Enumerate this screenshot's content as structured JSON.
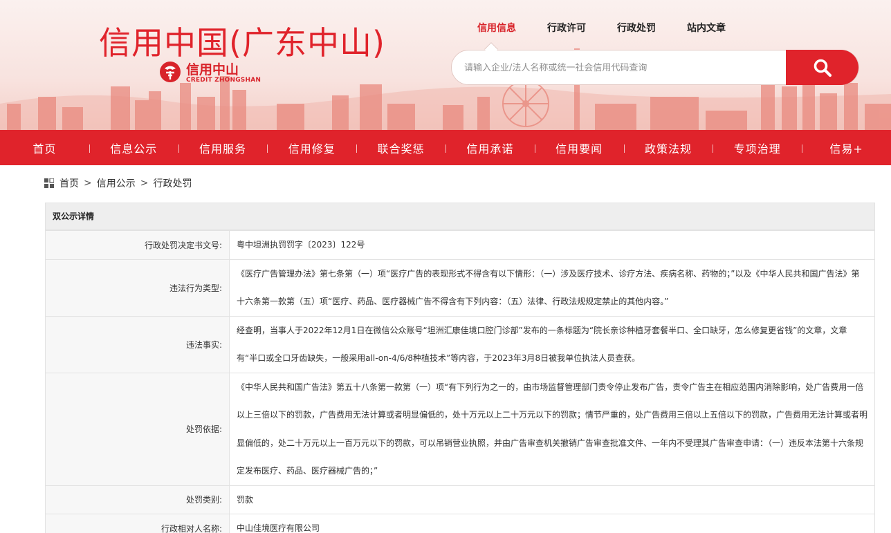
{
  "header": {
    "site_title": "信用中国(广东中山)",
    "logo_cn": "信用中山",
    "logo_en": "CREDIT ZHONGSHAN",
    "top_tabs": [
      {
        "label": "信用信息",
        "active": true
      },
      {
        "label": "行政许可",
        "active": false
      },
      {
        "label": "行政处罚",
        "active": false
      },
      {
        "label": "站内文章",
        "active": false
      }
    ],
    "search": {
      "placeholder": "请输入企业/法人名称或统一社会信用代码查询",
      "value": ""
    }
  },
  "nav": {
    "items": [
      "首页",
      "信息公示",
      "信用服务",
      "信用修复",
      "联合奖惩",
      "信用承诺",
      "信用要闻",
      "政策法规",
      "专项治理",
      "信易+"
    ]
  },
  "breadcrumb": {
    "items": [
      "首页",
      "信用公示",
      "行政处罚"
    ],
    "separator": ">"
  },
  "detail": {
    "title": "双公示详情",
    "rows": [
      {
        "label": "行政处罚决定书文号:",
        "value": "粤中坦洲执罚罚字〔2023〕122号"
      },
      {
        "label": "违法行为类型:",
        "value": "《医疗广告管理办法》第七条第（一）项“医疗广告的表现形式不得含有以下情形：（一）涉及医疗技术、诊疗方法、疾病名称、药物的；”以及《中华人民共和国广告法》第十六条第一款第（五）项“医疗、药品、医疗器械广告不得含有下列内容：（五）法律、行政法规规定禁止的其他内容。”"
      },
      {
        "label": "违法事实:",
        "value": "经查明，当事人于2022年12月1日在微信公众账号“坦洲汇康佳境口腔门诊部”发布的一条标题为“院长亲诊种植牙套餐半口、全口缺牙，怎么修复更省钱”的文章，文章有“半口或全口牙齿缺失，一般采用all-on-4/6/8种植技术”等内容，于2023年3月8日被我单位执法人员查获。"
      },
      {
        "label": "处罚依据:",
        "value": "《中华人民共和国广告法》第五十八条第一款第（一）项“有下列行为之一的，由市场监督管理部门责令停止发布广告，责令广告主在相应范围内消除影响，处广告费用一倍以上三倍以下的罚款，广告费用无法计算或者明显偏低的，处十万元以上二十万元以下的罚款；情节严重的，处广告费用三倍以上五倍以下的罚款，广告费用无法计算或者明显偏低的，处二十万元以上一百万元以下的罚款，可以吊销营业执照，并由广告审查机关撤销广告审查批准文件、一年内不受理其广告审查申请：（一）违反本法第十六条规定发布医疗、药品、医疗器械广告的；”"
      },
      {
        "label": "处罚类别:",
        "value": "罚款"
      },
      {
        "label": "行政相对人名称:",
        "value": "中山佳境医疗有限公司"
      }
    ]
  },
  "colors": {
    "brand_red": "#e0232b",
    "header_bg": "#f8e3df",
    "panel_head_bg": "#eeeeee",
    "label_bg": "#f7f7f7"
  }
}
